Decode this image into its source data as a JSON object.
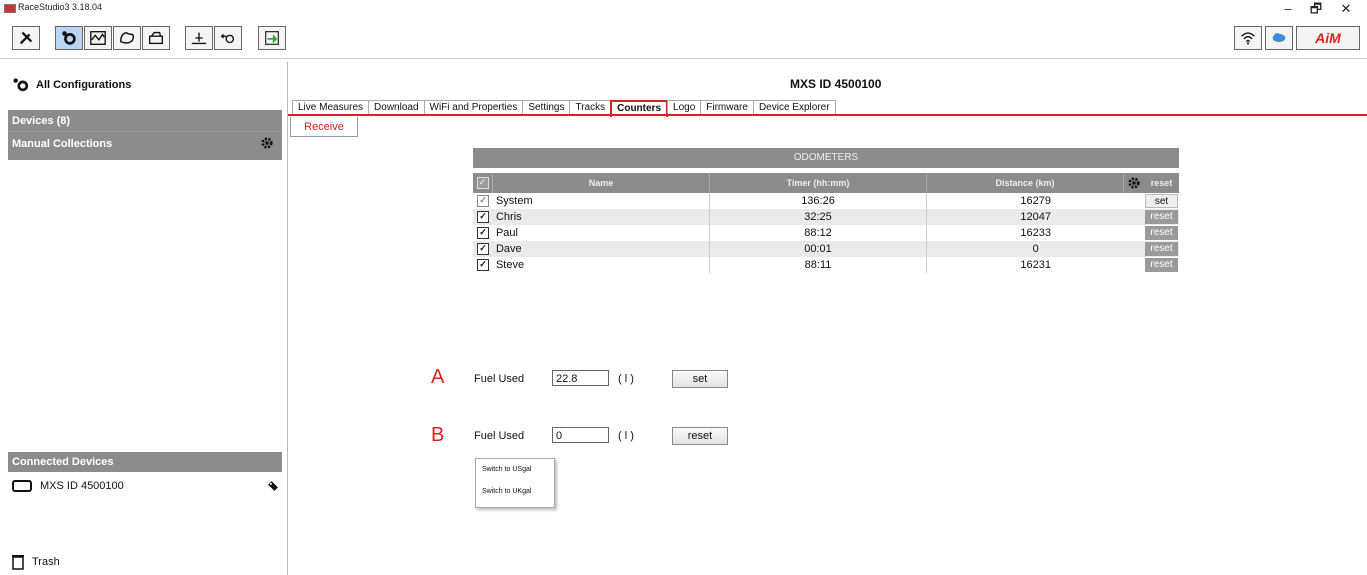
{
  "window": {
    "title": "RaceStudio3 3.18.04",
    "controls": [
      "–",
      "🗗",
      "✕"
    ]
  },
  "toolbar": {
    "icons": [
      "tools-icon",
      "configuration-icon",
      "analysis-icon",
      "tracks-icon",
      "race-vehicle-icon",
      "sensors-icon",
      "device-add-icon",
      "transfer-icon"
    ],
    "right_icons": [
      "wifi-icon",
      "cloud-icon",
      "aim-logo"
    ],
    "brand": "AiM"
  },
  "sidebar": {
    "all_configurations": "All Configurations",
    "devices": "Devices  (8)",
    "manual_collections": "Manual Collections",
    "connected_devices": "Connected Devices",
    "device_name": "MXS ID 4500100",
    "trash": "Trash"
  },
  "main": {
    "device_title": "MXS ID 4500100",
    "tabs": [
      {
        "label": "Live Measures"
      },
      {
        "label": "Download"
      },
      {
        "label": "WiFi and Properties"
      },
      {
        "label": "Settings"
      },
      {
        "label": "Tracks"
      },
      {
        "label": "Counters",
        "selected": true
      },
      {
        "label": "Logo"
      },
      {
        "label": "Firmware"
      },
      {
        "label": "Device Explorer"
      }
    ],
    "receive": "Receive"
  },
  "odometers": {
    "title": "ODOMETERS",
    "headers": {
      "name": "Name",
      "timer": "Timer (hh:mm)",
      "distance": "Distance (km)",
      "action": "reset"
    },
    "rows": [
      {
        "checked": true,
        "disabled": true,
        "name": "System",
        "timer": "136:26",
        "distance": "16279",
        "action": "set"
      },
      {
        "checked": true,
        "disabled": false,
        "name": "Chris",
        "timer": "32:25",
        "distance": "12047",
        "action": "reset"
      },
      {
        "checked": true,
        "disabled": false,
        "name": "Paul",
        "timer": "88:12",
        "distance": "16233",
        "action": "reset"
      },
      {
        "checked": true,
        "disabled": false,
        "name": "Dave",
        "timer": "00:01",
        "distance": "0",
        "action": "reset"
      },
      {
        "checked": true,
        "disabled": false,
        "name": "Steve",
        "timer": "88:11",
        "distance": "16231",
        "action": "reset"
      }
    ]
  },
  "fuel": {
    "a": {
      "marker": "A",
      "label": "Fuel Used",
      "value": "22.8",
      "unit": "( l )",
      "button": "set"
    },
    "b": {
      "marker": "B",
      "label": "Fuel Used",
      "value": "0",
      "unit": "( l )",
      "button": "reset"
    },
    "menu": [
      "Switch to USgal",
      "Switch to UKgal"
    ]
  }
}
